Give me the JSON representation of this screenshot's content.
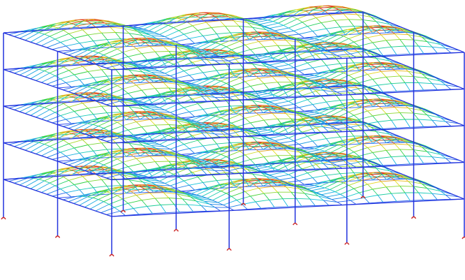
{
  "scene": {
    "description_visible_text": "",
    "floors": 5,
    "mesh": {
      "u_divisions": 26,
      "v_divisions": 20
    },
    "columns_grid": {
      "u_positions": [
        0,
        0.333,
        0.667,
        1.0
      ],
      "v_positions": [
        0,
        0.5,
        1.0
      ]
    },
    "bays": {
      "u": 3,
      "v": 2
    },
    "colors": {
      "frame": "#2233dd",
      "support": "#cc2222",
      "background": "#ffffff",
      "contour_low": "#2a3df0",
      "contour_mid": "#22cc44",
      "contour_high": "#e02020"
    }
  }
}
